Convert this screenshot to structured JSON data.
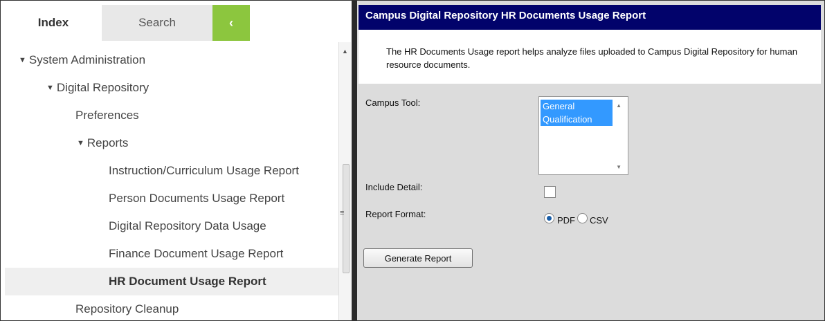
{
  "tabs": {
    "index": "Index",
    "search": "Search",
    "collapse_icon": "‹"
  },
  "tree": [
    {
      "label": "System Administration",
      "expanded": true,
      "level": 0,
      "selected": false
    },
    {
      "label": "Digital Repository",
      "expanded": true,
      "level": 1,
      "selected": false
    },
    {
      "label": "Preferences",
      "expanded": false,
      "level": 2,
      "selected": false
    },
    {
      "label": "Reports",
      "expanded": true,
      "level": 2,
      "selected": false
    },
    {
      "label": "Instruction/Curriculum Usage Report",
      "expanded": false,
      "level": 3,
      "selected": false
    },
    {
      "label": "Person Documents Usage Report",
      "expanded": false,
      "level": 3,
      "selected": false
    },
    {
      "label": "Digital Repository Data Usage",
      "expanded": false,
      "level": 3,
      "selected": false
    },
    {
      "label": "Finance Document Usage Report",
      "expanded": false,
      "level": 3,
      "selected": false
    },
    {
      "label": "HR Document Usage Report",
      "expanded": false,
      "level": 3,
      "selected": true
    },
    {
      "label": "Repository Cleanup",
      "expanded": false,
      "level": 2,
      "selected": false
    }
  ],
  "caret": "▼",
  "scroll": {
    "up_icon": "▲",
    "grip_icon": "≡"
  },
  "report": {
    "title": "Campus Digital Repository HR Documents Usage Report",
    "description": "The HR Documents Usage report helps analyze files uploaded to Campus Digital Repository for human resource documents.",
    "campus_tool_label": "Campus Tool:",
    "campus_tool_options": [
      "General",
      "Qualification"
    ],
    "include_detail_label": "Include Detail:",
    "include_detail_checked": false,
    "report_format_label": "Report Format:",
    "format_options": [
      "PDF",
      "CSV"
    ],
    "selected_format": "PDF",
    "generate_button": "Generate Report",
    "listbox_up_icon": "▲",
    "listbox_down_icon": "▼"
  },
  "colors": {
    "header_bg": "#02036b",
    "accent_green": "#8cc63e",
    "selection_blue": "#3399ff"
  }
}
